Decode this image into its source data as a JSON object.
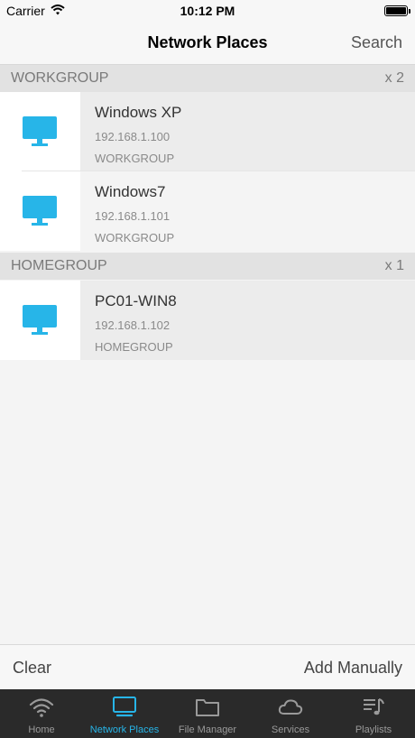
{
  "status_bar": {
    "carrier": "Carrier",
    "time": "10:12 PM"
  },
  "nav": {
    "title": "Network Places",
    "search_label": "Search"
  },
  "groups": [
    {
      "name": "WORKGROUP",
      "count": "x 2",
      "devices": [
        {
          "name": "Windows XP",
          "ip": "192.168.1.100",
          "group": "WORKGROUP",
          "icon": "computer-icon"
        },
        {
          "name": "Windows7",
          "ip": "192.168.1.101",
          "group": "WORKGROUP",
          "icon": "computer-icon"
        }
      ]
    },
    {
      "name": "HOMEGROUP",
      "count": "x 1",
      "devices": [
        {
          "name": "PC01-WIN8",
          "ip": "192.168.1.102",
          "group": "HOMEGROUP",
          "icon": "computer-icon"
        }
      ]
    }
  ],
  "actions": {
    "clear_label": "Clear",
    "add_label": "Add Manually"
  },
  "tabs": [
    {
      "label": "Home",
      "icon": "wifi-icon"
    },
    {
      "label": "Network Places",
      "icon": "computer-icon",
      "active": true
    },
    {
      "label": "File Manager",
      "icon": "folder-icon"
    },
    {
      "label": "Services",
      "icon": "cloud-icon"
    },
    {
      "label": "Playlists",
      "icon": "playlist-icon"
    }
  ],
  "colors": {
    "accent": "#27b5e8",
    "tab_bar": "#2a2a2a",
    "section_header": "#e2e2e2"
  }
}
